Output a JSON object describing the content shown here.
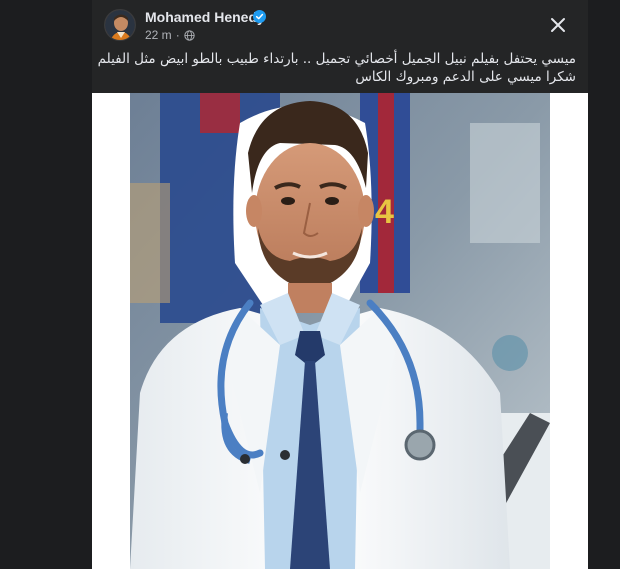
{
  "post": {
    "author": "Mohamed Henedy",
    "timestamp": "22 m",
    "separator": "·",
    "verified": true,
    "privacy_icon": "globe-icon",
    "text_lines": [
      "ميسي يحتفل بفيلم نبيل الجميل أخصائي تجميل .. بارتداء طبيب بالطو ابيض مثل الفيلم",
      "شكرا ميسي على الدعم ومبروك الكاس"
    ]
  },
  "icons": {
    "close": "close-icon",
    "verified": "verified-badge-icon",
    "avatar": "avatar"
  },
  "colors": {
    "background": "#1c1d1f",
    "card": "#242526",
    "primary_text": "#e4e6eb",
    "secondary_text": "#b0b3b8",
    "verified_blue": "#1d9bf0",
    "media_bg": "#ffffff"
  }
}
